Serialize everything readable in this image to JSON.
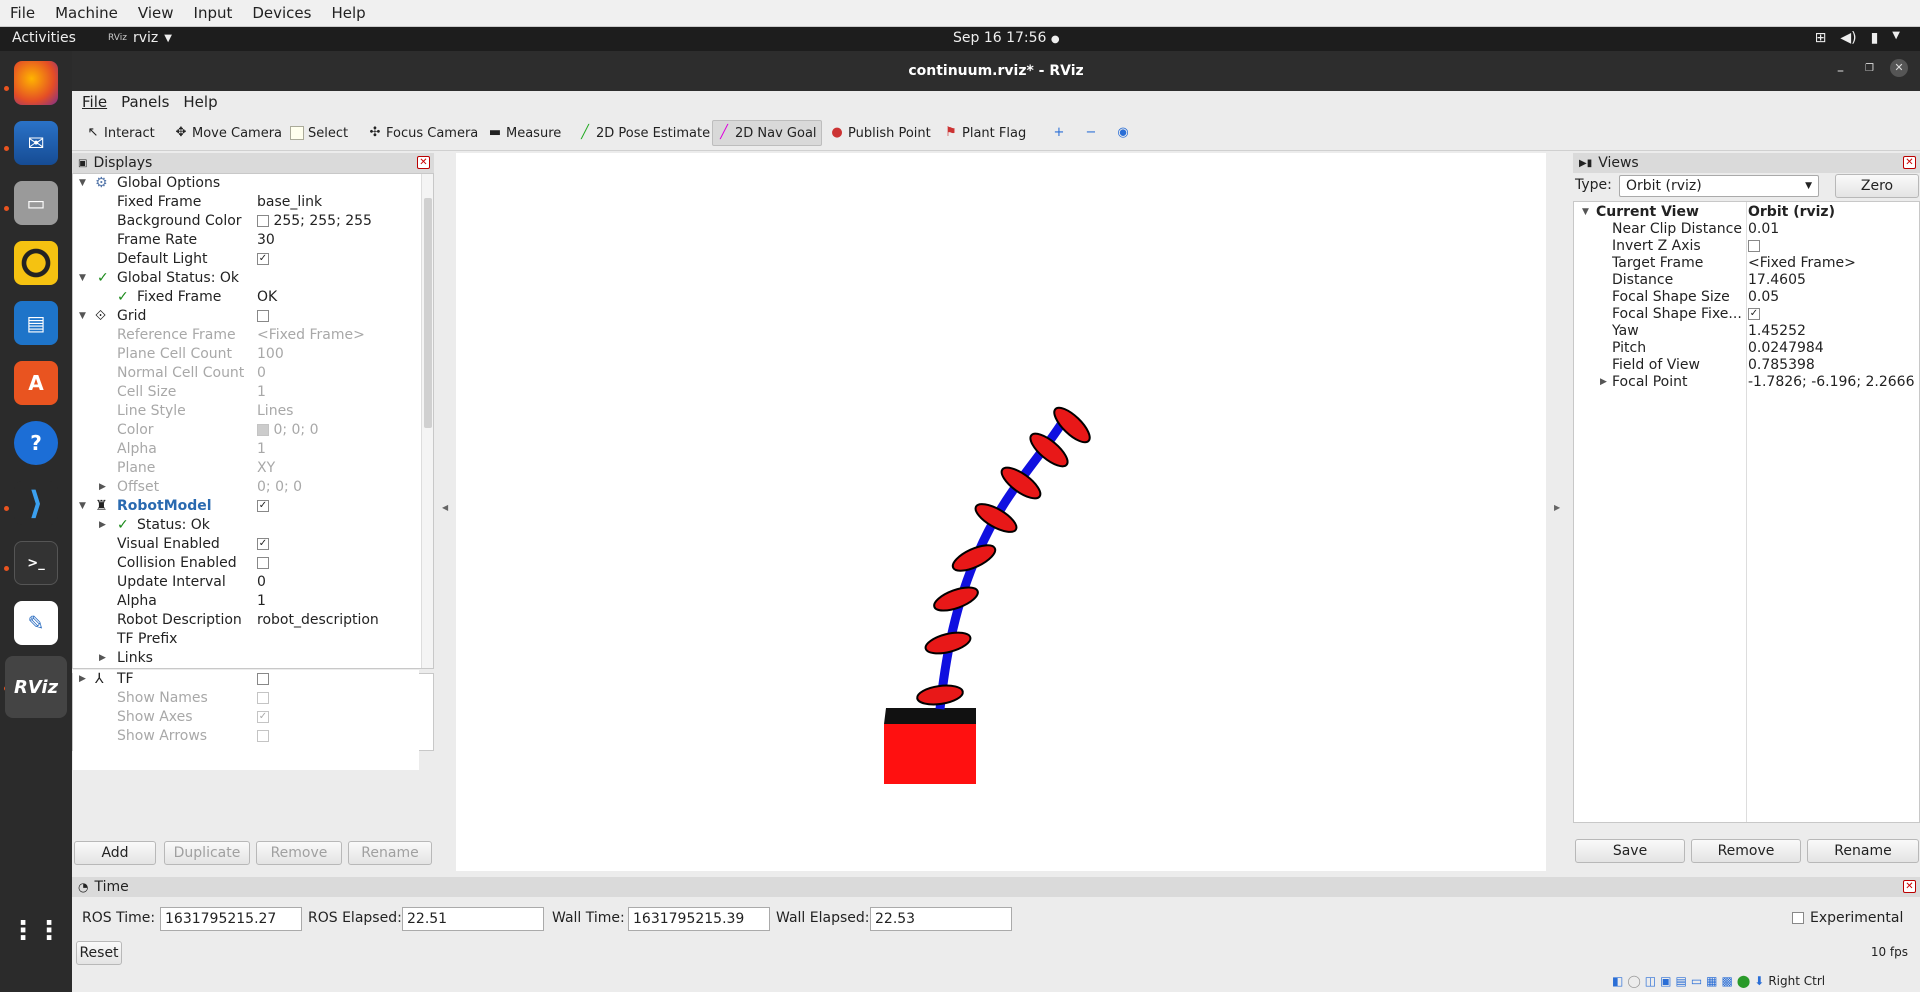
{
  "host_menu": [
    "File",
    "Machine",
    "View",
    "Input",
    "Devices",
    "Help"
  ],
  "topbar": {
    "activities": "Activities",
    "app": "rviz",
    "clock": "Sep 16  17:56"
  },
  "window": {
    "title": "continuum.rviz* - RViz"
  },
  "app_menu": [
    "File",
    "Panels",
    "Help"
  ],
  "toolbar": [
    "Interact",
    "Move Camera",
    "Select",
    "Focus Camera",
    "Measure",
    "2D Pose Estimate",
    "2D Nav Goal",
    "Publish Point",
    "Plant Flag"
  ],
  "displays": {
    "title": "Displays",
    "rows": [
      {
        "k": "Global Options",
        "v": ""
      },
      {
        "k": "Fixed Frame",
        "v": "base_link"
      },
      {
        "k": "Background Color",
        "v": "255; 255; 255"
      },
      {
        "k": "Frame Rate",
        "v": "30"
      },
      {
        "k": "Default Light",
        "v": "✓"
      },
      {
        "k": "Global Status: Ok",
        "v": ""
      },
      {
        "k": "Fixed Frame",
        "v": "OK"
      },
      {
        "k": "Grid",
        "v": ""
      },
      {
        "k": "Reference Frame",
        "v": "<Fixed Frame>"
      },
      {
        "k": "Plane Cell Count",
        "v": "100"
      },
      {
        "k": "Normal Cell Count",
        "v": "0"
      },
      {
        "k": "Cell Size",
        "v": "1"
      },
      {
        "k": "Line Style",
        "v": "Lines"
      },
      {
        "k": "Color",
        "v": "0; 0; 0"
      },
      {
        "k": "Alpha",
        "v": "1"
      },
      {
        "k": "Plane",
        "v": "XY"
      },
      {
        "k": "Offset",
        "v": "0; 0; 0"
      },
      {
        "k": "RobotModel",
        "v": "✓"
      },
      {
        "k": "Status: Ok",
        "v": ""
      },
      {
        "k": "Visual Enabled",
        "v": "✓"
      },
      {
        "k": "Collision Enabled",
        "v": ""
      },
      {
        "k": "Update Interval",
        "v": "0"
      },
      {
        "k": "Alpha",
        "v": "1"
      },
      {
        "k": "Robot Description",
        "v": "robot_description"
      },
      {
        "k": "TF Prefix",
        "v": ""
      },
      {
        "k": "Links",
        "v": ""
      },
      {
        "k": "TF",
        "v": ""
      },
      {
        "k": "Show Names",
        "v": ""
      },
      {
        "k": "Show Axes",
        "v": "✓"
      },
      {
        "k": "Show Arrows",
        "v": ""
      }
    ],
    "buttons": [
      "Add",
      "Duplicate",
      "Remove",
      "Rename"
    ]
  },
  "views": {
    "title": "Views",
    "type_label": "Type:",
    "type_value": "Orbit (rviz)",
    "zero": "Zero",
    "rows": [
      {
        "k": "Current View",
        "v": "Orbit (rviz)"
      },
      {
        "k": "Near Clip Distance",
        "v": "0.01"
      },
      {
        "k": "Invert Z Axis",
        "v": ""
      },
      {
        "k": "Target Frame",
        "v": "<Fixed Frame>"
      },
      {
        "k": "Distance",
        "v": "17.4605"
      },
      {
        "k": "Focal Shape Size",
        "v": "0.05"
      },
      {
        "k": "Focal Shape Fixe...",
        "v": "✓"
      },
      {
        "k": "Yaw",
        "v": "1.45252"
      },
      {
        "k": "Pitch",
        "v": "0.0247984"
      },
      {
        "k": "Field of View",
        "v": "0.785398"
      },
      {
        "k": "Focal Point",
        "v": "-1.7826; -6.196; 2.2666"
      }
    ],
    "buttons": [
      "Save",
      "Remove",
      "Rename"
    ]
  },
  "time": {
    "title": "Time",
    "ros_time_label": "ROS Time:",
    "ros_time": "1631795215.27",
    "ros_elapsed_label": "ROS Elapsed:",
    "ros_elapsed": "22.51",
    "wall_time_label": "Wall Time:",
    "wall_time": "1631795215.39",
    "wall_elapsed_label": "Wall Elapsed:",
    "wall_elapsed": "22.53",
    "experimental": "Experimental",
    "reset": "Reset",
    "fps": "10 fps"
  },
  "host_status": "Right Ctrl",
  "colors": {
    "robot_base": "#ff1010",
    "robot_backbone": "#1010e0",
    "disk": "#e81818"
  }
}
